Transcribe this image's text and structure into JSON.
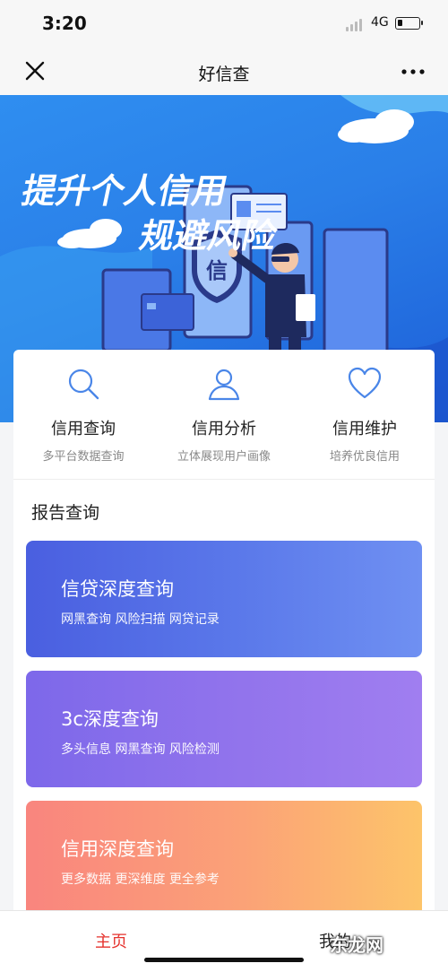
{
  "status_bar": {
    "time": "3:20",
    "network": "4G"
  },
  "nav": {
    "title": "好信查",
    "close_icon": "close-icon",
    "more_icon": "more-icon"
  },
  "banner": {
    "headline_1": "提升个人信用",
    "headline_2": "规避风险",
    "shield_char": "信"
  },
  "features": [
    {
      "title": "信用查询",
      "subtitle": "多平台数据查询",
      "icon": "search-icon"
    },
    {
      "title": "信用分析",
      "subtitle": "立体展现用户画像",
      "icon": "user-icon"
    },
    {
      "title": "信用维护",
      "subtitle": "培养优良信用",
      "icon": "heart-icon"
    }
  ],
  "report": {
    "section_title": "报告查询",
    "cards": [
      {
        "title": "信贷深度查询",
        "subtitle": "网黑查询 风险扫描 网贷记录",
        "color": "#4a5fe0"
      },
      {
        "title": "3c深度查询",
        "subtitle": "多头信息 网黑查询 风险检测",
        "color": "#8a70eb"
      },
      {
        "title": "信用深度查询",
        "subtitle": "更多数据 更深维度 更全参考",
        "color": "#fba277"
      }
    ]
  },
  "tab_bar": {
    "home": "主页",
    "mine": "我的",
    "active_color": "#e5322d"
  },
  "watermark": "东龙网"
}
